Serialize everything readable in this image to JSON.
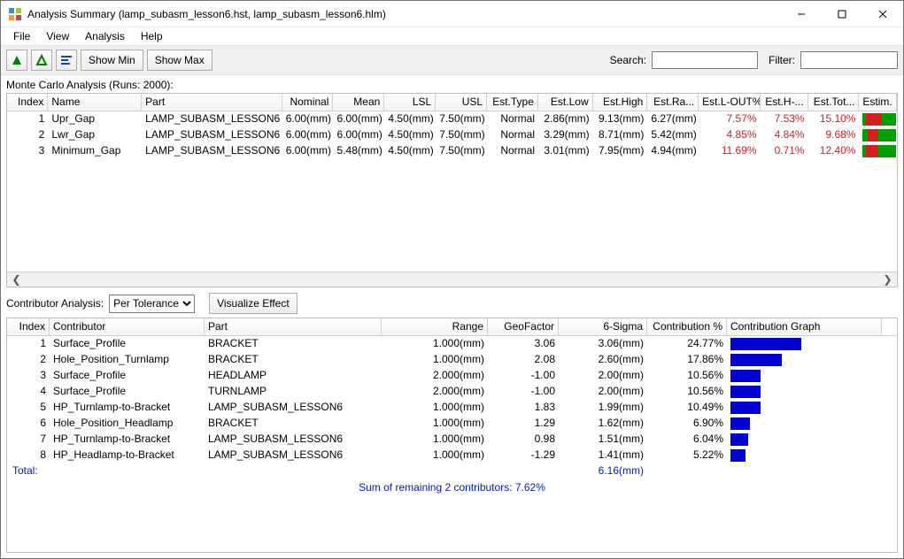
{
  "window": {
    "title": "Analysis Summary (lamp_subasm_lesson6.hst, lamp_subasm_lesson6.hlm)"
  },
  "menu": {
    "file": "File",
    "view": "View",
    "analysis": "Analysis",
    "help": "Help"
  },
  "toolbar": {
    "show_min": "Show Min",
    "show_max": "Show Max",
    "search_label": "Search:",
    "filter_label": "Filter:",
    "search_value": "",
    "filter_value": ""
  },
  "mc": {
    "heading": "Monte Carlo Analysis (Runs: 2000):",
    "headers": [
      "Index",
      "Name",
      "Part",
      "Nominal",
      "Mean",
      "LSL",
      "USL",
      "Est.Type",
      "Est.Low",
      "Est.High",
      "Est.Ra...",
      "Est.L-OUT%",
      "Est.H-...",
      "Est.Tot...",
      "Estim."
    ],
    "rows": [
      {
        "index": "1",
        "name": "Upr_Gap",
        "part": "LAMP_SUBASM_LESSON6",
        "nominal": "6.00(mm)",
        "mean": "6.00(mm)",
        "lsl": "4.50(mm)",
        "usl": "7.50(mm)",
        "type": "Normal",
        "low": "2.86(mm)",
        "high": "9.13(mm)",
        "range": "6.27(mm)",
        "lout": "7.57%",
        "hout": "7.53%",
        "tot": "15.10%",
        "bar": {
          "g1": 4,
          "r": 18,
          "g2": 16
        }
      },
      {
        "index": "2",
        "name": "Lwr_Gap",
        "part": "LAMP_SUBASM_LESSON6",
        "nominal": "6.00(mm)",
        "mean": "6.00(mm)",
        "lsl": "4.50(mm)",
        "usl": "7.50(mm)",
        "type": "Normal",
        "low": "3.29(mm)",
        "high": "8.71(mm)",
        "range": "5.42(mm)",
        "lout": "4.85%",
        "hout": "4.84%",
        "tot": "9.68%",
        "bar": {
          "g1": 6,
          "r": 12,
          "g2": 20
        }
      },
      {
        "index": "3",
        "name": "Minimum_Gap",
        "part": "LAMP_SUBASM_LESSON6",
        "nominal": "6.00(mm)",
        "mean": "5.48(mm)",
        "lsl": "4.50(mm)",
        "usl": "7.50(mm)",
        "type": "Normal",
        "low": "3.01(mm)",
        "high": "7.95(mm)",
        "range": "4.94(mm)",
        "lout": "11.69%",
        "hout": "0.71%",
        "tot": "12.40%",
        "bar": {
          "g1": 4,
          "r": 14,
          "g2": 20
        }
      }
    ]
  },
  "contrib": {
    "label": "Contributor Analysis:",
    "mode": "Per Tolerance",
    "visualize": "Visualize Effect",
    "headers": [
      "Index",
      "Contributor",
      "Part",
      "Range",
      "GeoFactor",
      "6-Sigma",
      "Contribution %",
      "Contribution Graph"
    ],
    "rows": [
      {
        "index": "1",
        "contributor": "Surface_Profile",
        "part": "BRACKET",
        "range": "1.000(mm)",
        "geo": "3.06",
        "sigma": "3.06(mm)",
        "pct": "24.77%",
        "bar": 80
      },
      {
        "index": "2",
        "contributor": "Hole_Position_Turnlamp",
        "part": "BRACKET",
        "range": "1.000(mm)",
        "geo": "2.08",
        "sigma": "2.60(mm)",
        "pct": "17.86%",
        "bar": 58
      },
      {
        "index": "3",
        "contributor": "Surface_Profile",
        "part": "HEADLAMP",
        "range": "2.000(mm)",
        "geo": "-1.00",
        "sigma": "2.00(mm)",
        "pct": "10.56%",
        "bar": 34
      },
      {
        "index": "4",
        "contributor": "Surface_Profile",
        "part": "TURNLAMP",
        "range": "2.000(mm)",
        "geo": "-1.00",
        "sigma": "2.00(mm)",
        "pct": "10.56%",
        "bar": 34
      },
      {
        "index": "5",
        "contributor": "HP_Turnlamp-to-Bracket",
        "part": "LAMP_SUBASM_LESSON6",
        "range": "1.000(mm)",
        "geo": "1.83",
        "sigma": "1.99(mm)",
        "pct": "10.49%",
        "bar": 34
      },
      {
        "index": "6",
        "contributor": "Hole_Position_Headlamp",
        "part": "BRACKET",
        "range": "1.000(mm)",
        "geo": "1.29",
        "sigma": "1.62(mm)",
        "pct": "6.90%",
        "bar": 22
      },
      {
        "index": "7",
        "contributor": "HP_Turnlamp-to-Bracket",
        "part": "LAMP_SUBASM_LESSON6",
        "range": "1.000(mm)",
        "geo": "0.98",
        "sigma": "1.51(mm)",
        "pct": "6.04%",
        "bar": 20
      },
      {
        "index": "8",
        "contributor": "HP_Headlamp-to-Bracket",
        "part": "LAMP_SUBASM_LESSON6",
        "range": "1.000(mm)",
        "geo": "-1.29",
        "sigma": "1.41(mm)",
        "pct": "5.22%",
        "bar": 17
      }
    ],
    "total_label": "Total:",
    "total_sigma": "6.16(mm)",
    "sum_line": "Sum of remaining 2 contributors: 7.62%"
  }
}
